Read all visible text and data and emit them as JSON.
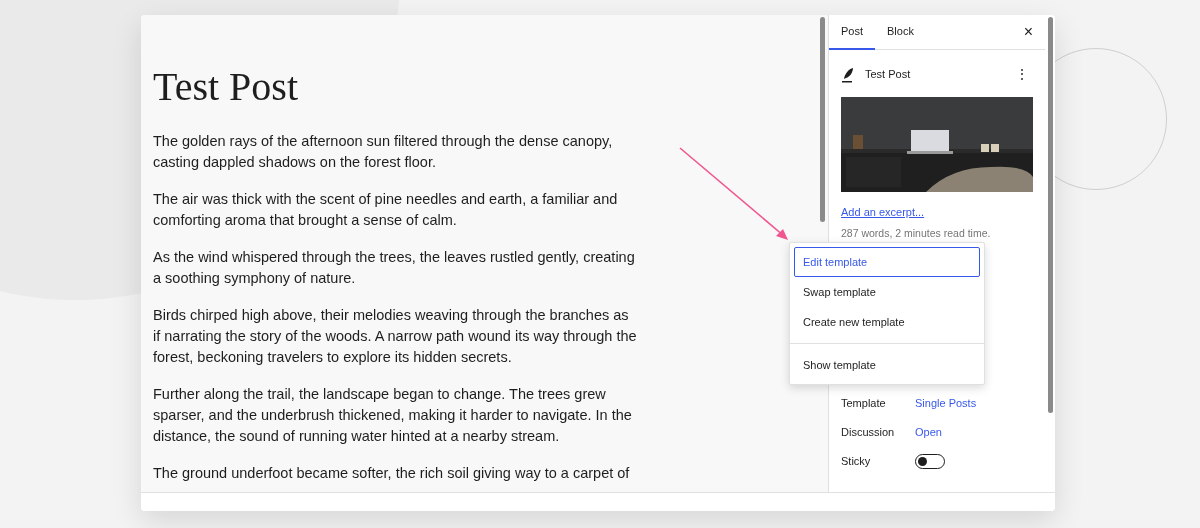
{
  "editor": {
    "title": "Test Post",
    "paragraphs": [
      "The golden rays of the afternoon sun filtered through the dense canopy, casting dappled shadows on the forest floor.",
      "The air was thick with the scent of pine needles and earth, a familiar and comforting aroma that brought a sense of calm.",
      "As the wind whispered through the trees, the leaves rustled gently, creating a soothing symphony of nature.",
      "Birds chirped high above, their melodies weaving through the branches as if narrating the story of the woods. A narrow path wound its way through the forest, beckoning travelers to explore its hidden secrets.",
      "Further along the trail, the landscape began to change. The trees grew sparser, and the underbrush thickened, making it harder to navigate. In the distance, the sound of running water hinted at a nearby stream.",
      "The ground underfoot became softer, the rich soil giving way to a carpet of"
    ]
  },
  "sidebar": {
    "tabs": [
      {
        "label": "Post",
        "selected": true
      },
      {
        "label": "Block",
        "selected": false
      }
    ],
    "close": "×",
    "post_title": "Test Post",
    "more": "⋮",
    "excerpt_link": "Add an excerpt...",
    "stats": "287 words, 2 minutes read time.",
    "rows": [
      {
        "label": "Template",
        "value": "Single Posts",
        "kind": "link"
      },
      {
        "label": "Discussion",
        "value": "Open",
        "kind": "link"
      },
      {
        "label": "Sticky",
        "kind": "toggle",
        "on": false
      }
    ]
  },
  "menu": {
    "groups": [
      [
        {
          "label": "Edit template",
          "selected": true
        },
        {
          "label": "Swap template",
          "selected": false
        },
        {
          "label": "Create new template",
          "selected": false
        }
      ],
      [
        {
          "label": "Show template",
          "selected": false
        }
      ]
    ]
  }
}
